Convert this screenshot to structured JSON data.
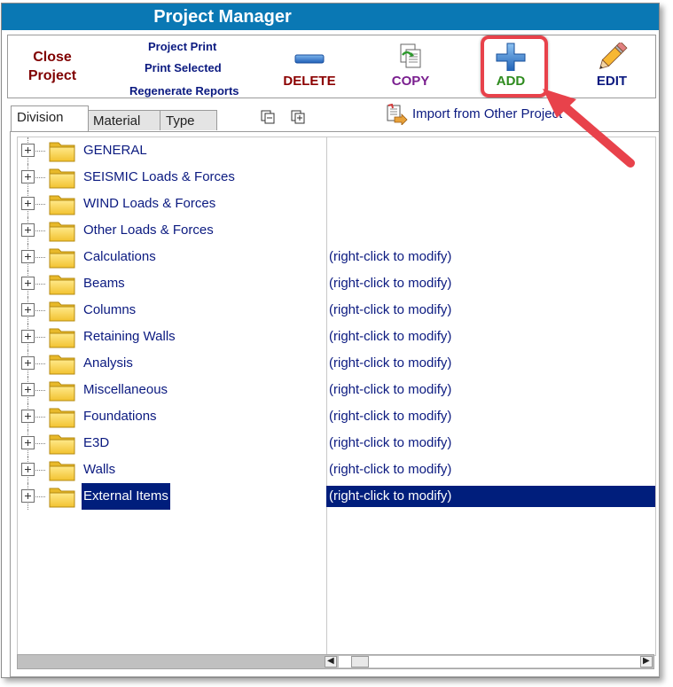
{
  "window": {
    "title": "Project Manager"
  },
  "toolbar": {
    "close_line1": "Close",
    "close_line2": "Project",
    "project_print": "Project Print",
    "print_selected": "Print Selected",
    "regenerate_reports": "Regenerate Reports",
    "delete_label": "DELETE",
    "copy_label": "COPY",
    "add_label": "ADD",
    "edit_label": "EDIT"
  },
  "tabs": [
    {
      "label": "Division",
      "active": true
    },
    {
      "label": "Material",
      "active": false
    },
    {
      "label": "Type",
      "active": false
    }
  ],
  "import": {
    "label": "Import from Other Project"
  },
  "tree": {
    "rows": [
      {
        "name": "GENERAL",
        "note": ""
      },
      {
        "name": "SEISMIC Loads & Forces",
        "note": ""
      },
      {
        "name": "WIND Loads & Forces",
        "note": ""
      },
      {
        "name": "Other Loads & Forces",
        "note": ""
      },
      {
        "name": "Calculations",
        "note": "(right-click to modify)"
      },
      {
        "name": "Beams",
        "note": "(right-click to modify)"
      },
      {
        "name": "Columns",
        "note": "(right-click to modify)"
      },
      {
        "name": "Retaining Walls",
        "note": "(right-click to modify)"
      },
      {
        "name": "Analysis",
        "note": "(right-click to modify)"
      },
      {
        "name": "Miscellaneous",
        "note": "(right-click to modify)"
      },
      {
        "name": "Foundations",
        "note": "(right-click to modify)"
      },
      {
        "name": "E3D",
        "note": "(right-click to modify)"
      },
      {
        "name": "Walls",
        "note": "(right-click to modify)"
      },
      {
        "name": "External Items",
        "note": "(right-click to modify)",
        "selected": true
      }
    ]
  },
  "colors": {
    "title_bar": "#0a78b4",
    "delete": "#8b0000",
    "copy": "#7a1f8f",
    "add": "#2e8b1e",
    "edit": "#0b1a80",
    "highlight": "#e8424b",
    "selection": "#001e7c"
  }
}
